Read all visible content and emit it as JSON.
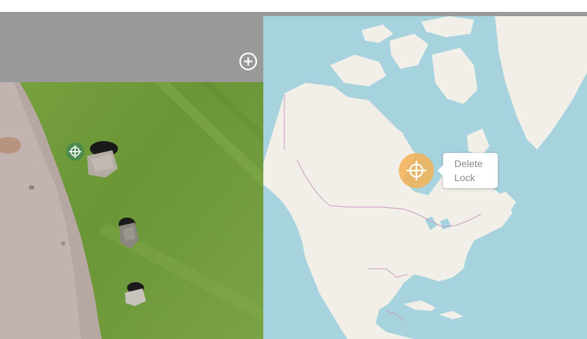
{
  "left_panel": {
    "toolbar": {
      "add_icon": "plus-circle-icon"
    },
    "image_marker_icon": "crosshair-icon"
  },
  "right_panel": {
    "map_marker_icon": "crosshair-icon",
    "popup": {
      "delete_label": "Delete",
      "lock_label": "Lock"
    }
  },
  "colors": {
    "toolbar_bg": "#999999",
    "grass": "#6f9a3a",
    "gravel": "#b8a8a4",
    "water": "#a7d3df",
    "land": "#f2efe9",
    "border": "#c89ac0",
    "image_marker": "#4f8a4f",
    "map_marker": "#f3b255"
  }
}
